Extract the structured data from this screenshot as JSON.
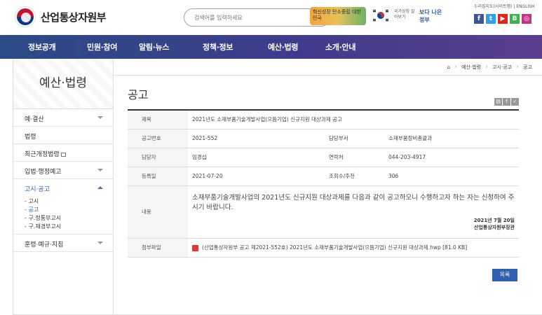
{
  "header": {
    "logo_text": "산업통상자원부",
    "search_placeholder": "검색어를 입력하세요",
    "banner_text": "혁신성장 탄소중립 대한민국",
    "flag_text": "국가상징 알아보기",
    "banner2_text": "보다 나은 정부",
    "utils": "누리집지도(사이트맵) | ENGLISH",
    "social": [
      "f",
      "t",
      "▶",
      "B",
      "◎"
    ],
    "social_colors": [
      "#3b5998",
      "#2aa3ef",
      "#e62117",
      "#3cb44b",
      "#c13584"
    ]
  },
  "gnb": [
    "정보공개",
    "민원·참여",
    "알림·뉴스",
    "정책·정보",
    "예산·법령",
    "소개·안내"
  ],
  "lnb": {
    "title": "예산·법령",
    "items": [
      {
        "label": "예·결산"
      },
      {
        "label": "법령"
      },
      {
        "label": "최근개정법령"
      },
      {
        "label": "입법·행정예고"
      },
      {
        "label": "고시·공고"
      },
      {
        "label": "훈령·예규·지침"
      }
    ],
    "sub": [
      "고시",
      "공고",
      "구.정통부고시",
      "구.재경부고시"
    ]
  },
  "breadcrumb": [
    "예산·법령",
    "고시·공고",
    "공고"
  ],
  "page_title": "공고",
  "detail": {
    "labels": {
      "title": "제목",
      "number": "공고번호",
      "dept": "담당부서",
      "manager": "담당자",
      "contact": "연락처",
      "date": "등록일",
      "views": "조회수/추천",
      "content": "내용",
      "attachment": "첨부파일"
    },
    "title": "2021년도 소재부품기술개발사업(으뜸기업) 신규지원 대상과제 공고",
    "number": "2021-552",
    "dept": "소재부품장비총괄과",
    "manager": "임경섭",
    "contact": "044-203-4917",
    "date": "2021-07-20",
    "views": "306",
    "content": "소재부품기술개발사업의 2021년도 신규지원 대상과제를 다음과 같이 공고하오니 수행하고자  하는 자는 신청하여 주시기 바랍니다.",
    "sign_date": "2021년 7월 20일",
    "sign_name": "산업통상자원부장관",
    "attachment": "(산업통상자원부 공고 제2021-552호) 2021년도 소재부품기술개발사업(으뜸기업) 신규지원 대상과제.hwp [81.0 KB]"
  },
  "list_button": "목록"
}
